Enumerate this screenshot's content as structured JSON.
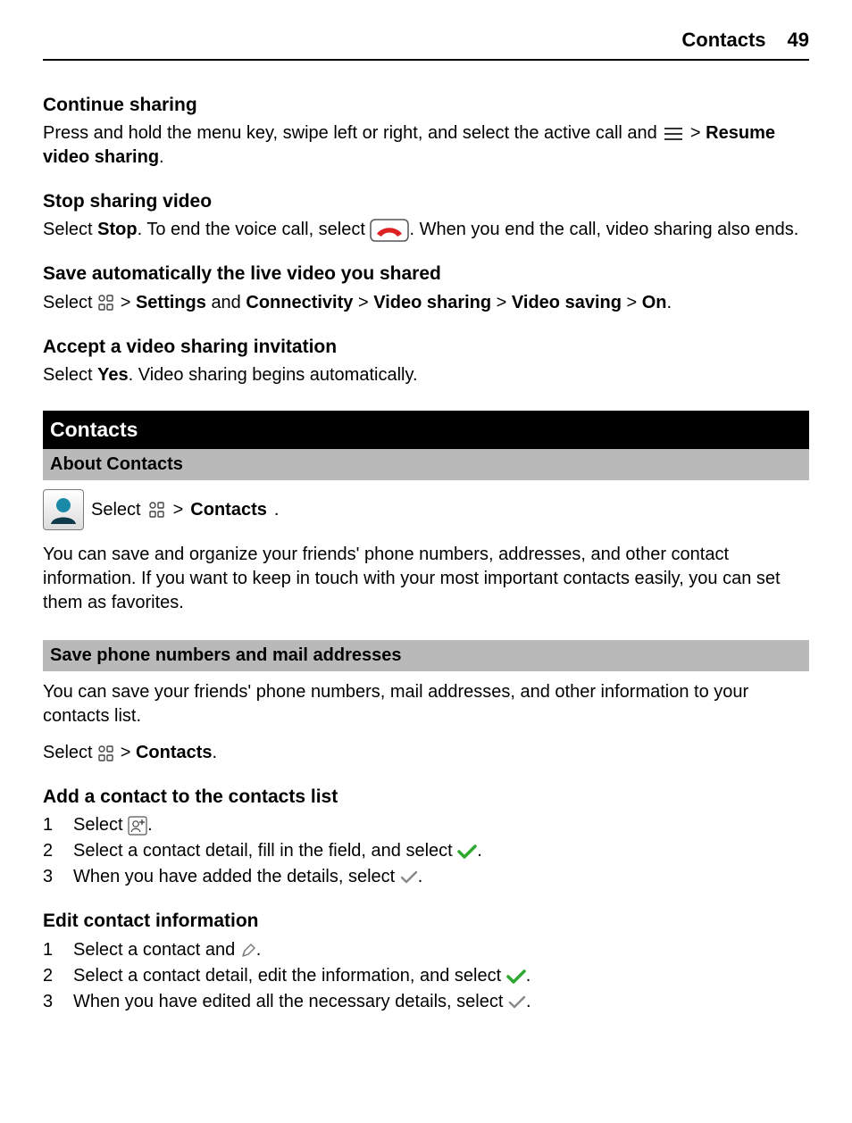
{
  "header": {
    "section": "Contacts",
    "page": "49"
  },
  "s1": {
    "h": "Continue sharing",
    "p1a": "Press and hold the menu key, swipe left or right, and select the active call and ",
    "p1b": " > ",
    "p1c": "Resume video sharing",
    "p1d": "."
  },
  "s2": {
    "h": "Stop sharing video",
    "t1": "Select ",
    "stop": "Stop",
    "t2": ". To end the voice call, select ",
    "t3": ". When you end the call, video sharing also ends."
  },
  "s3": {
    "h": "Save automatically the live video you shared",
    "t1": "Select ",
    "t2": " > ",
    "settings": "Settings",
    "t3": " and ",
    "connectivity": "Connectivity",
    "videosharing": "Video sharing",
    "videosaving": "Video saving",
    "on": "On",
    "period": "."
  },
  "s4": {
    "h": "Accept a video sharing invitation",
    "t1": "Select ",
    "yes": "Yes",
    "t2": ". Video sharing begins automatically."
  },
  "contactsBar": "Contacts",
  "aboutBar": "About Contacts",
  "about": {
    "t1": "Select ",
    "t2": " > ",
    "contacts": "Contacts",
    "period": ".",
    "desc": "You can save and organize your friends' phone numbers, addresses, and other contact information. If you want to keep in touch with your most important contacts easily, you can set them as favorites."
  },
  "saveBar": "Save phone numbers and mail addresses",
  "save": {
    "desc": "You can save your friends' phone numbers, mail addresses, and other information to your contacts list.",
    "t1": "Select ",
    "t2": " > ",
    "contacts": "Contacts",
    "period": "."
  },
  "add": {
    "h": "Add a contact to the contacts list",
    "n1": "1",
    "n2": "2",
    "n3": "3",
    "l1a": "Select ",
    "l1b": ".",
    "l2a": "Select a contact detail, fill in the field, and select ",
    "l2b": ".",
    "l3a": "When you have added the details, select ",
    "l3b": "."
  },
  "edit": {
    "h": "Edit contact information",
    "n1": "1",
    "n2": "2",
    "n3": "3",
    "l1a": "Select a contact and ",
    "l1b": ".",
    "l2a": "Select a contact detail, edit the information, and select ",
    "l2b": ".",
    "l3a": "When you have edited all the necessary details, select ",
    "l3b": "."
  }
}
